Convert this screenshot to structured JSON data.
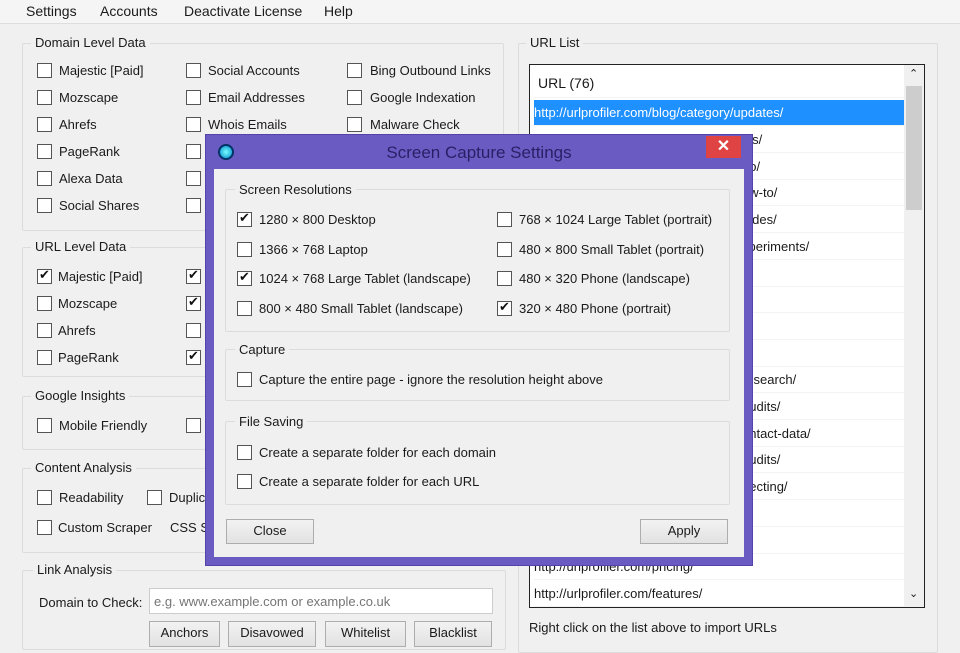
{
  "menu": [
    "Settings",
    "Accounts",
    "Deactivate License",
    "Help"
  ],
  "domain_level": {
    "title": "Domain Level Data",
    "col1": [
      {
        "label": "Majestic [Paid]",
        "checked": false
      },
      {
        "label": "Mozscape",
        "checked": false
      },
      {
        "label": "Ahrefs",
        "checked": false
      },
      {
        "label": "PageRank",
        "checked": false
      },
      {
        "label": "Alexa Data",
        "checked": false
      },
      {
        "label": "Social Shares",
        "checked": false
      }
    ],
    "col2": [
      {
        "label": "Social Accounts",
        "checked": false
      },
      {
        "label": "Email Addresses",
        "checked": false
      },
      {
        "label": "Whois Emails",
        "checked": false
      }
    ],
    "col3": [
      {
        "label": "Bing Outbound Links",
        "checked": false
      },
      {
        "label": "Google Indexation",
        "checked": false
      },
      {
        "label": "Malware Check",
        "checked": false
      }
    ]
  },
  "url_level": {
    "title": "URL Level Data",
    "col1": [
      {
        "label": "Majestic [Paid]",
        "checked": true
      },
      {
        "label": "Mozscape",
        "checked": false
      },
      {
        "label": "Ahrefs",
        "checked": false
      },
      {
        "label": "PageRank",
        "checked": false
      }
    ]
  },
  "google_insights": {
    "title": "Google Insights",
    "mobile_friendly": "Mobile Friendly"
  },
  "content_analysis": {
    "title": "Content Analysis",
    "readability": "Readability",
    "duplicate": "Duplic",
    "custom_scraper": "Custom Scraper",
    "css": "CSS S"
  },
  "link_analysis": {
    "title": "Link Analysis",
    "domain_label": "Domain to Check:",
    "domain_placeholder": "e.g. www.example.com or example.co.uk",
    "buttons": [
      "Anchors",
      "Disavowed",
      "Whitelist",
      "Blacklist"
    ]
  },
  "url_list": {
    "title": "URL List",
    "header": "URL (76)",
    "selected": "http://urlprofiler.com/blog/category/updates/",
    "fragments": [
      "ols/",
      "eo/",
      "ow-to/",
      "uides/",
      "xperiments/",
      "",
      "",
      "",
      "",
      "research/",
      "audits/",
      "ontact-data/",
      "audits/",
      "pecting/",
      "s/",
      ""
    ],
    "pricing": "http://urlprofiler.com/pricing/",
    "features": "http://urlprofiler.com/features/",
    "hint": "Right click on the list above to import URLs"
  },
  "dialog": {
    "title": "Screen Capture Settings",
    "resolutions_title": "Screen Resolutions",
    "resolutions_left": [
      {
        "label": "1280 × 800 Desktop",
        "checked": true
      },
      {
        "label": "1366 × 768 Laptop",
        "checked": false
      },
      {
        "label": "1024 × 768 Large Tablet (landscape)",
        "checked": true
      },
      {
        "label": "800 × 480 Small Tablet (landscape)",
        "checked": false
      }
    ],
    "resolutions_right": [
      {
        "label": "768 × 1024 Large Tablet (portrait)",
        "checked": false
      },
      {
        "label": "480 × 800 Small Tablet (portrait)",
        "checked": false
      },
      {
        "label": "480 × 320 Phone (landscape)",
        "checked": false
      },
      {
        "label": "320 × 480 Phone (portrait)",
        "checked": true
      }
    ],
    "capture_title": "Capture",
    "capture_entire": "Capture the entire page - ignore the resolution height above",
    "file_saving_title": "File Saving",
    "folder_domain": "Create a separate folder for each domain",
    "folder_url": "Create a separate folder for each URL",
    "close": "Close",
    "apply": "Apply"
  },
  "colors": {
    "dialog_frame": "#6a5bc2",
    "selection": "#1e90ff",
    "close_button": "#e04343"
  }
}
